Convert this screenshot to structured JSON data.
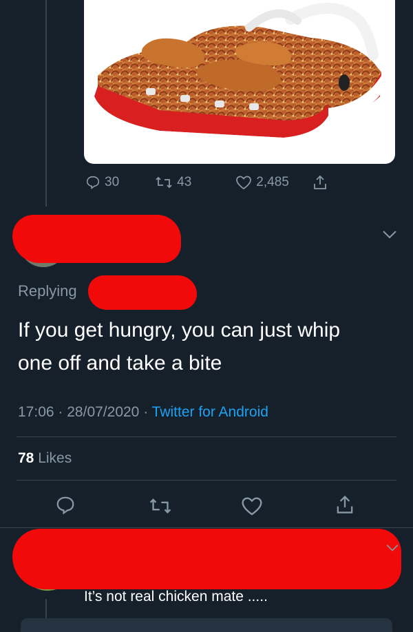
{
  "parent_tweet": {
    "stats": {
      "replies": "30",
      "retweets": "43",
      "likes": "2,485"
    }
  },
  "main_tweet": {
    "replying_label": "Replying",
    "text_line1": "If you get hungry, you can just whip",
    "text_line2": "one off and take a bite",
    "time": "17:06",
    "date": "28/07/2020",
    "separator": "·",
    "source": "Twitter for Android",
    "likes_count": "78",
    "likes_label": "Likes"
  },
  "reply_tweet": {
    "text": "It’s not real chicken mate ....."
  },
  "colors": {
    "background": "#15202b",
    "muted": "#8899a6",
    "link": "#1da1f2",
    "divider": "#38444d",
    "redaction": "#f20a0a"
  },
  "icons": {
    "reply": "reply-icon",
    "retweet": "retweet-icon",
    "like": "heart-icon",
    "share": "share-icon",
    "more": "chevron-down-icon"
  }
}
